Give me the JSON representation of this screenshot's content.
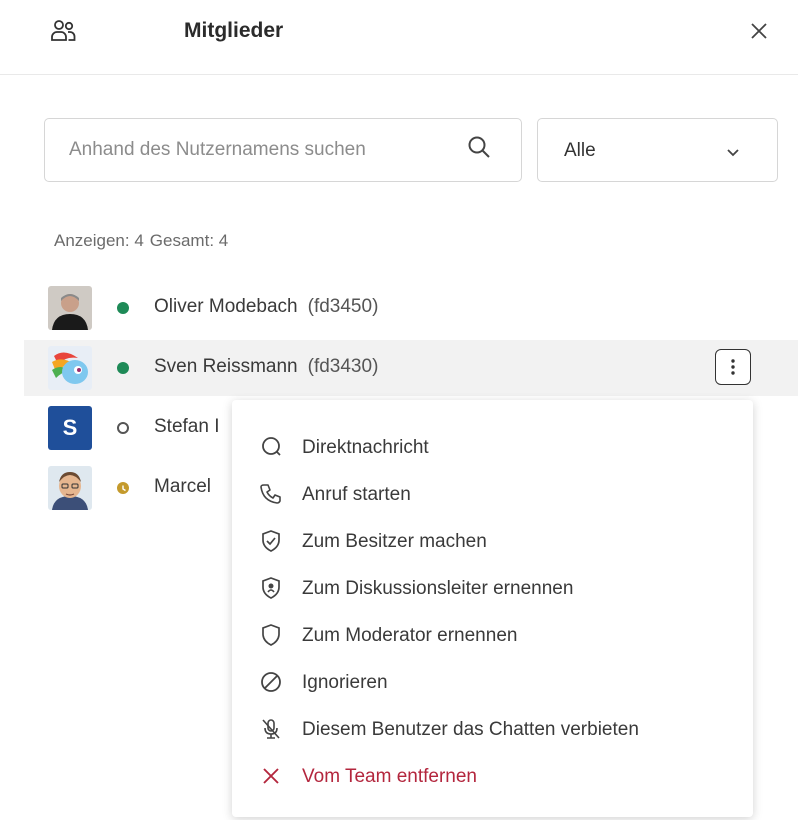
{
  "panel": {
    "title": "Mitglieder",
    "header_icon": "people-icon",
    "close_icon": "close-icon"
  },
  "search": {
    "placeholder": "Anhand des Nutzernamens suchen",
    "value": "",
    "icon": "search-icon"
  },
  "filter": {
    "selected": "Alle",
    "icon": "chevron-down-icon"
  },
  "counts": {
    "shown": "Anzeigen: 4",
    "total": "Gesamt: 4"
  },
  "members": [
    {
      "name": "Oliver Modebach",
      "id": "(fd3450)",
      "status": "online",
      "avatar": "photo-avatar"
    },
    {
      "name": "Sven Reissmann",
      "id": "(fd3430)",
      "status": "online",
      "avatar": "pony-avatar",
      "highlighted": true
    },
    {
      "name": "Stefan I",
      "id": "",
      "status": "offline",
      "avatar": "letter-avatar",
      "initial": "S"
    },
    {
      "name": "Marcel",
      "id": "",
      "status": "away",
      "avatar": "cartoon-avatar"
    }
  ],
  "context_menu": [
    {
      "label": "Direktnachricht",
      "icon": "chat-bubble-icon"
    },
    {
      "label": "Anruf starten",
      "icon": "phone-icon"
    },
    {
      "label": "Zum Besitzer machen",
      "icon": "shield-check-icon"
    },
    {
      "label": "Zum Diskussionsleiter ernennen",
      "icon": "shield-lock-icon"
    },
    {
      "label": "Zum Moderator ernennen",
      "icon": "shield-icon"
    },
    {
      "label": "Ignorieren",
      "icon": "block-icon"
    },
    {
      "label": "Diesem Benutzer das Chatten verbieten",
      "icon": "mic-off-icon"
    },
    {
      "label": "Vom Team entfernen",
      "icon": "x-icon",
      "danger": true
    }
  ],
  "colors": {
    "online": "#1e8a57",
    "away": "#c49a2c",
    "danger": "#b3263d",
    "letter_avatar": "#1f4f9a",
    "highlight": "#f2f2f2"
  }
}
